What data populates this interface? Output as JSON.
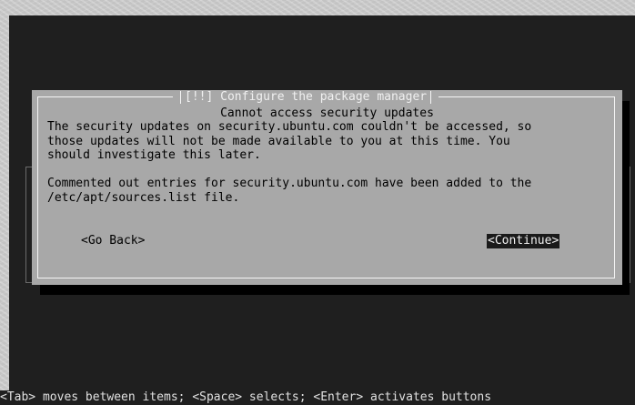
{
  "dialog": {
    "title": "[!!] Configure the package manager",
    "subtitle": "Cannot access security updates",
    "body": "The security updates on security.ubuntu.com couldn't be accessed, so\nthose updates will not be made available to you at this time. You\nshould investigate this later.\n\nCommented out entries for security.ubuntu.com have been added to the\n/etc/apt/sources.list file.",
    "buttons": {
      "go_back": "<Go Back>",
      "continue": "<Continue>"
    }
  },
  "status_bar": "<Tab> moves between items; <Space> selects; <Enter> activates buttons"
}
